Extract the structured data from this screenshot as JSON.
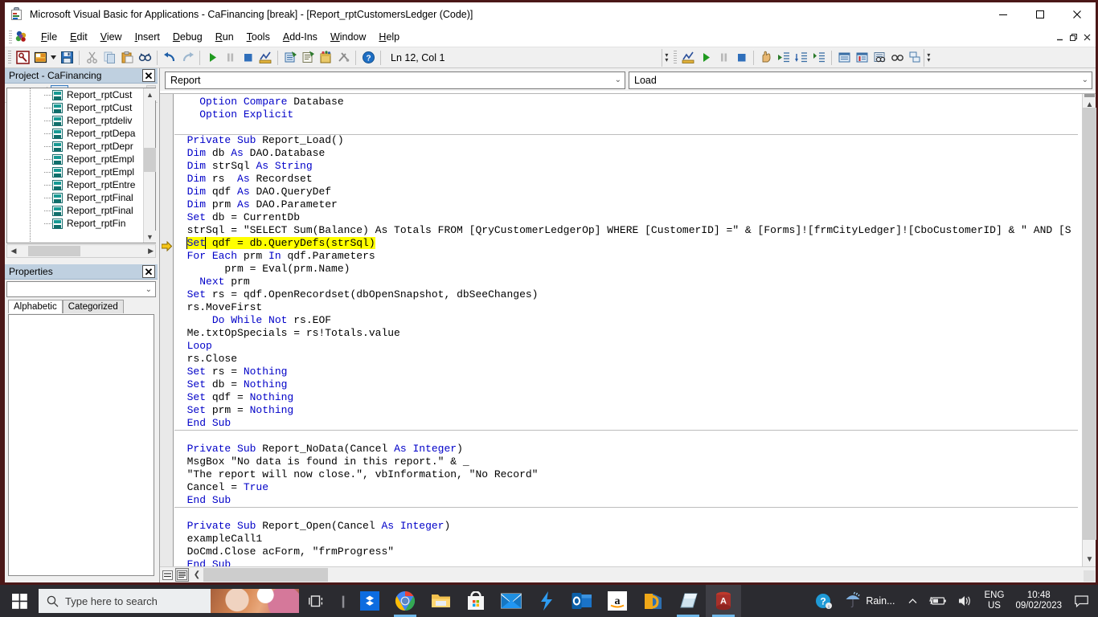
{
  "window": {
    "title": "Microsoft Visual Basic for Applications - CaFinancing [break] - [Report_rptCustomersLedger (Code)]",
    "app_icon": "vba-document-icon",
    "controls": {
      "minimize": "–",
      "maximize": "□",
      "close": "✕"
    },
    "mdi_controls": {
      "minimize": "_",
      "restore": "❐",
      "close": "✕"
    }
  },
  "menu": {
    "items": [
      {
        "label": "File",
        "accel": "F"
      },
      {
        "label": "Edit",
        "accel": "E"
      },
      {
        "label": "View",
        "accel": "V"
      },
      {
        "label": "Insert",
        "accel": "I"
      },
      {
        "label": "Debug",
        "accel": "D"
      },
      {
        "label": "Run",
        "accel": "R"
      },
      {
        "label": "Tools",
        "accel": "T"
      },
      {
        "label": "Add-Ins",
        "accel": "A"
      },
      {
        "label": "Window",
        "accel": "W"
      },
      {
        "label": "Help",
        "accel": "H"
      }
    ]
  },
  "toolbar": {
    "position_label": "Ln 12, Col 1",
    "buttons": [
      {
        "name": "view-access-icon"
      },
      {
        "name": "insert-module-icon"
      },
      {
        "name": "save-icon"
      },
      {
        "name": "cut-icon"
      },
      {
        "name": "copy-icon"
      },
      {
        "name": "paste-icon"
      },
      {
        "name": "find-icon"
      },
      {
        "name": "undo-icon"
      },
      {
        "name": "redo-icon"
      },
      {
        "name": "run-icon"
      },
      {
        "name": "break-icon"
      },
      {
        "name": "reset-icon"
      },
      {
        "name": "design-mode-icon"
      },
      {
        "name": "project-explorer-icon"
      },
      {
        "name": "properties-window-icon"
      },
      {
        "name": "object-browser-icon"
      },
      {
        "name": "toolbox-icon"
      },
      {
        "name": "help-icon"
      }
    ],
    "debug_buttons": [
      {
        "name": "design-mode-icon"
      },
      {
        "name": "run-icon"
      },
      {
        "name": "break-icon"
      },
      {
        "name": "reset-icon"
      },
      {
        "name": "toggle-breakpoint-icon"
      },
      {
        "name": "step-into-icon"
      },
      {
        "name": "step-over-icon"
      },
      {
        "name": "step-out-icon"
      },
      {
        "name": "locals-window-icon"
      },
      {
        "name": "immediate-window-icon"
      },
      {
        "name": "watch-window-icon"
      },
      {
        "name": "quick-watch-icon"
      },
      {
        "name": "call-stack-icon"
      }
    ]
  },
  "project_panel": {
    "title": "Project - CaFinancing",
    "close_label": "✕",
    "toolbar": [
      {
        "name": "view-code-icon"
      },
      {
        "name": "view-object-icon"
      },
      {
        "name": "toggle-folders-icon"
      }
    ],
    "tree_items": [
      "Report_rptCust",
      "Report_rptCust",
      "Report_rptdeliv",
      "Report_rptDepa",
      "Report_rptDepr",
      "Report_rptEmpl",
      "Report_rptEmpl",
      "Report_rptEntre",
      "Report_rptFinal",
      "Report_rptFinal",
      "Report_rptFin"
    ]
  },
  "properties_panel": {
    "title": "Properties",
    "close_label": "✕",
    "selected_object": "",
    "tabs": [
      {
        "label": "Alphabetic",
        "selected": true
      },
      {
        "label": "Categorized",
        "selected": false
      }
    ]
  },
  "code_window": {
    "object_combo": "Report",
    "procedure_combo": "Load",
    "view_buttons": [
      {
        "name": "procedure-view-icon",
        "selected": false
      },
      {
        "name": "full-module-view-icon",
        "selected": true
      }
    ],
    "current_line_marker": "next-statement-arrow",
    "lines": [
      {
        "segments": [
          {
            "t": "    ",
            "k": false
          },
          {
            "t": "Option Compare",
            "k": true
          },
          {
            "t": " Database",
            "k": false
          }
        ]
      },
      {
        "segments": [
          {
            "t": "    ",
            "k": false
          },
          {
            "t": "Option Explicit",
            "k": true
          }
        ]
      },
      {
        "segments": [
          {
            "t": "",
            "k": false
          }
        ],
        "rule": true
      },
      {
        "segments": [
          {
            "t": "  ",
            "k": false
          },
          {
            "t": "Private Sub",
            "k": true
          },
          {
            "t": " Report_Load()",
            "k": false
          }
        ]
      },
      {
        "segments": [
          {
            "t": "  ",
            "k": false
          },
          {
            "t": "Dim",
            "k": true
          },
          {
            "t": " db ",
            "k": false
          },
          {
            "t": "As",
            "k": true
          },
          {
            "t": " DAO.Database",
            "k": false
          }
        ]
      },
      {
        "segments": [
          {
            "t": "  ",
            "k": false
          },
          {
            "t": "Dim",
            "k": true
          },
          {
            "t": " strSql ",
            "k": false
          },
          {
            "t": "As String",
            "k": true
          }
        ]
      },
      {
        "segments": [
          {
            "t": "  ",
            "k": false
          },
          {
            "t": "Dim",
            "k": true
          },
          {
            "t": " rs  ",
            "k": false
          },
          {
            "t": "As",
            "k": true
          },
          {
            "t": " Recordset",
            "k": false
          }
        ]
      },
      {
        "segments": [
          {
            "t": "  ",
            "k": false
          },
          {
            "t": "Dim",
            "k": true
          },
          {
            "t": " qdf ",
            "k": false
          },
          {
            "t": "As",
            "k": true
          },
          {
            "t": " DAO.QueryDef",
            "k": false
          }
        ]
      },
      {
        "segments": [
          {
            "t": "  ",
            "k": false
          },
          {
            "t": "Dim",
            "k": true
          },
          {
            "t": " prm ",
            "k": false
          },
          {
            "t": "As",
            "k": true
          },
          {
            "t": " DAO.Parameter",
            "k": false
          }
        ]
      },
      {
        "segments": [
          {
            "t": "  ",
            "k": false
          },
          {
            "t": "Set",
            "k": true
          },
          {
            "t": " db = CurrentDb",
            "k": false
          }
        ]
      },
      {
        "segments": [
          {
            "t": "  strSql = \"SELECT Sum(Balance) As Totals FROM [QryCustomerLedgerOp] WHERE [CustomerID] =\" & [Forms]![frmCityLedger]![CboCustomerID] & \" AND [S",
            "k": false
          }
        ]
      },
      {
        "highlight": true,
        "segments": [
          {
            "t": "  ",
            "k": false,
            "outside": true
          },
          {
            "t": "Set",
            "k": true
          },
          {
            "t": " qdf = db.QueryDefs(strSql)",
            "k": false
          }
        ]
      },
      {
        "segments": [
          {
            "t": "  ",
            "k": false
          },
          {
            "t": "For Each",
            "k": true
          },
          {
            "t": " prm ",
            "k": false
          },
          {
            "t": "In",
            "k": true
          },
          {
            "t": " qdf.Parameters",
            "k": false
          }
        ]
      },
      {
        "segments": [
          {
            "t": "        prm = Eval(prm.Name)",
            "k": false
          }
        ]
      },
      {
        "segments": [
          {
            "t": "    ",
            "k": false
          },
          {
            "t": "Next",
            "k": true
          },
          {
            "t": " prm",
            "k": false
          }
        ]
      },
      {
        "segments": [
          {
            "t": "  ",
            "k": false
          },
          {
            "t": "Set",
            "k": true
          },
          {
            "t": " rs = qdf.OpenRecordset(dbOpenSnapshot, dbSeeChanges)",
            "k": false
          }
        ]
      },
      {
        "segments": [
          {
            "t": "  rs.MoveFirst",
            "k": false
          }
        ]
      },
      {
        "segments": [
          {
            "t": "      ",
            "k": false
          },
          {
            "t": "Do While Not",
            "k": true
          },
          {
            "t": " rs.EOF",
            "k": false
          }
        ]
      },
      {
        "segments": [
          {
            "t": "  Me.txtOpSpecials = rs!Totals.value",
            "k": false
          }
        ]
      },
      {
        "segments": [
          {
            "t": "  ",
            "k": false
          },
          {
            "t": "Loop",
            "k": true
          }
        ]
      },
      {
        "segments": [
          {
            "t": "  rs.Close",
            "k": false
          }
        ]
      },
      {
        "segments": [
          {
            "t": "  ",
            "k": false
          },
          {
            "t": "Set",
            "k": true
          },
          {
            "t": " rs = ",
            "k": false
          },
          {
            "t": "Nothing",
            "k": true
          }
        ]
      },
      {
        "segments": [
          {
            "t": "  ",
            "k": false
          },
          {
            "t": "Set",
            "k": true
          },
          {
            "t": " db = ",
            "k": false
          },
          {
            "t": "Nothing",
            "k": true
          }
        ]
      },
      {
        "segments": [
          {
            "t": "  ",
            "k": false
          },
          {
            "t": "Set",
            "k": true
          },
          {
            "t": " qdf = ",
            "k": false
          },
          {
            "t": "Nothing",
            "k": true
          }
        ]
      },
      {
        "segments": [
          {
            "t": "  ",
            "k": false
          },
          {
            "t": "Set",
            "k": true
          },
          {
            "t": " prm = ",
            "k": false
          },
          {
            "t": "Nothing",
            "k": true
          }
        ]
      },
      {
        "segments": [
          {
            "t": "  ",
            "k": false
          },
          {
            "t": "End Sub",
            "k": true
          }
        ],
        "rule": true
      },
      {
        "segments": [
          {
            "t": "",
            "k": false
          }
        ]
      },
      {
        "segments": [
          {
            "t": "  ",
            "k": false
          },
          {
            "t": "Private Sub",
            "k": true
          },
          {
            "t": " Report_NoData(Cancel ",
            "k": false
          },
          {
            "t": "As Integer",
            "k": true
          },
          {
            "t": ")",
            "k": false
          }
        ]
      },
      {
        "segments": [
          {
            "t": "  MsgBox \"No data is found in this report.\" & _",
            "k": false
          }
        ]
      },
      {
        "segments": [
          {
            "t": "  \"The report will now close.\", vbInformation, \"No Record\"",
            "k": false
          }
        ]
      },
      {
        "segments": [
          {
            "t": "  Cancel = ",
            "k": false
          },
          {
            "t": "True",
            "k": true
          }
        ]
      },
      {
        "segments": [
          {
            "t": "  ",
            "k": false
          },
          {
            "t": "End Sub",
            "k": true
          }
        ],
        "rule": true
      },
      {
        "segments": [
          {
            "t": "",
            "k": false
          }
        ]
      },
      {
        "segments": [
          {
            "t": "  ",
            "k": false
          },
          {
            "t": "Private Sub",
            "k": true
          },
          {
            "t": " Report_Open(Cancel ",
            "k": false
          },
          {
            "t": "As Integer",
            "k": true
          },
          {
            "t": ")",
            "k": false
          }
        ]
      },
      {
        "segments": [
          {
            "t": "  exampleCall1",
            "k": false
          }
        ]
      },
      {
        "segments": [
          {
            "t": "  DoCmd.Close acForm, \"frmProgress\"",
            "k": false
          }
        ]
      },
      {
        "segments": [
          {
            "t": "  ",
            "k": false
          },
          {
            "t": "End Sub",
            "k": true
          }
        ]
      }
    ],
    "overflow_fragment": "[S"
  },
  "taskbar": {
    "start_icon": "windows-start-icon",
    "search_placeholder": "Type here to search",
    "search_icon": "search-icon",
    "task_view_icon": "task-view-icon",
    "apps": [
      {
        "name": "dropbox-icon",
        "active": false,
        "running": false
      },
      {
        "name": "chrome-icon",
        "active": false,
        "running": true
      },
      {
        "name": "file-explorer-icon",
        "active": false,
        "running": false
      },
      {
        "name": "microsoft-store-icon",
        "active": false,
        "running": false
      },
      {
        "name": "mail-icon",
        "active": false,
        "running": false
      },
      {
        "name": "lightning-icon",
        "active": false,
        "running": false
      },
      {
        "name": "outlook-icon",
        "active": false,
        "running": true
      },
      {
        "name": "amazon-icon",
        "active": false,
        "running": false
      },
      {
        "name": "media-player-icon",
        "active": false,
        "running": true
      },
      {
        "name": "sticky-notes-icon",
        "active": false,
        "running": true
      },
      {
        "name": "microsoft-access-icon",
        "active": true,
        "running": true
      }
    ],
    "tray": {
      "help_icon": "help-question-icon",
      "weather_icon": "rain-umbrella-icon",
      "weather_label": "Rain...",
      "chevron_icon": "show-hidden-icons-chevron",
      "battery_icon": "battery-charging-icon",
      "volume_icon": "speaker-icon",
      "language_line1": "ENG",
      "language_line2": "US",
      "time": "10:48",
      "date": "09/02/2023",
      "action_center_icon": "notification-icon"
    }
  }
}
